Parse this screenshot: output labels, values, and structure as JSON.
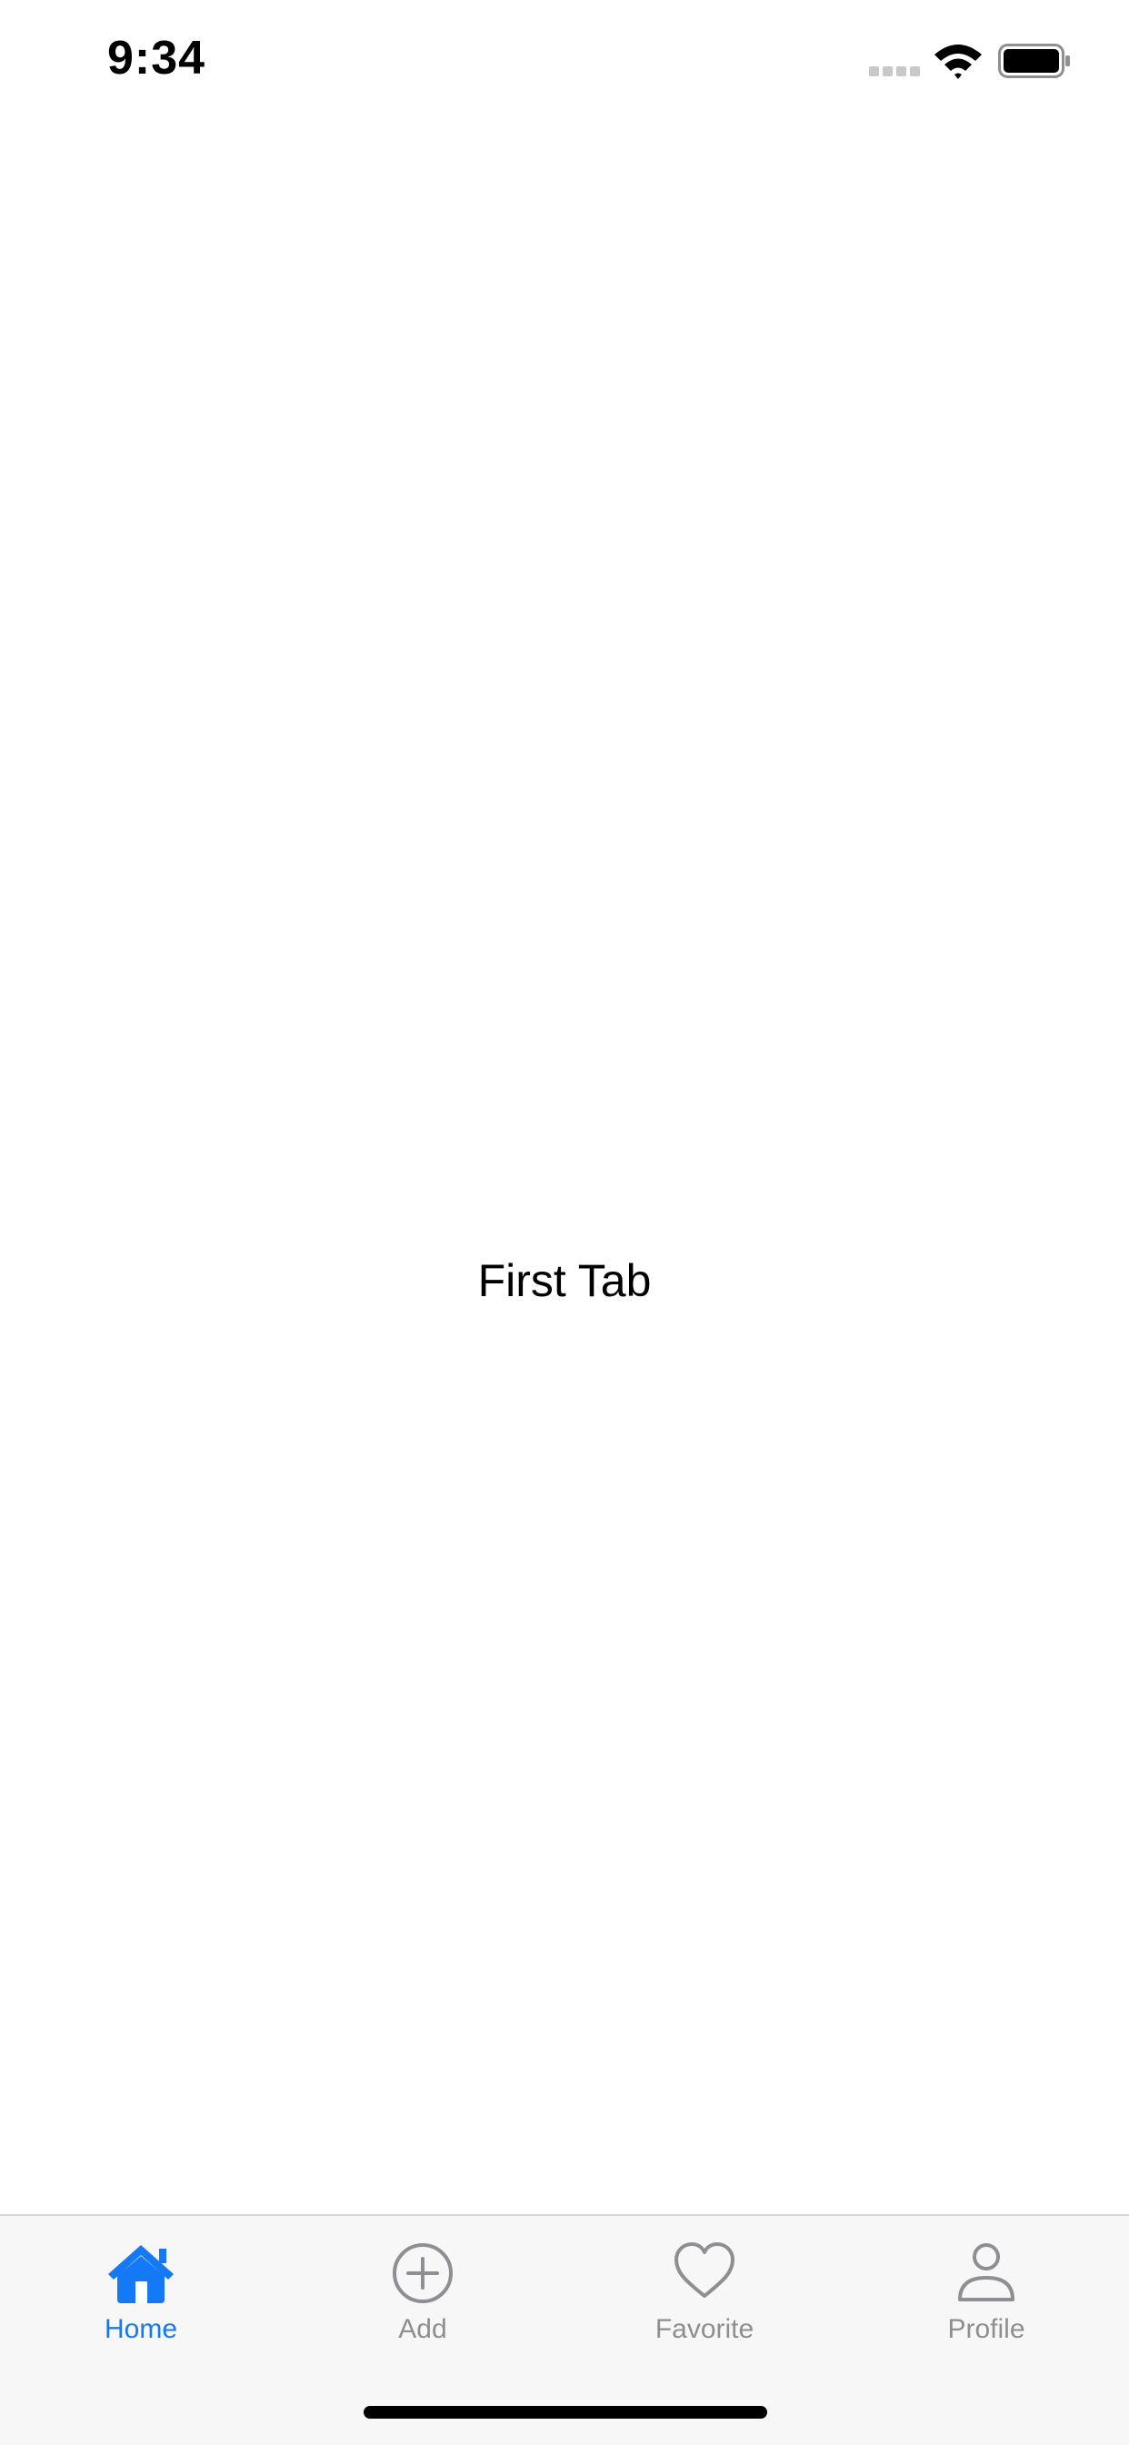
{
  "status_bar": {
    "time": "9:34",
    "icons": [
      "cellular-signal-icon",
      "wifi-icon",
      "battery-icon"
    ]
  },
  "main": {
    "text": "First Tab"
  },
  "tab_bar": {
    "tabs": [
      {
        "label": "Home",
        "icon": "home-icon",
        "selected": true
      },
      {
        "label": "Add",
        "icon": "add-circle-icon",
        "selected": false
      },
      {
        "label": "Favorite",
        "icon": "heart-icon",
        "selected": false
      },
      {
        "label": "Profile",
        "icon": "person-icon",
        "selected": false
      }
    ]
  },
  "colors": {
    "accent": "#1479f6",
    "inactive": "#8e8e93",
    "tab_bar_background": "#f7f7f7"
  }
}
